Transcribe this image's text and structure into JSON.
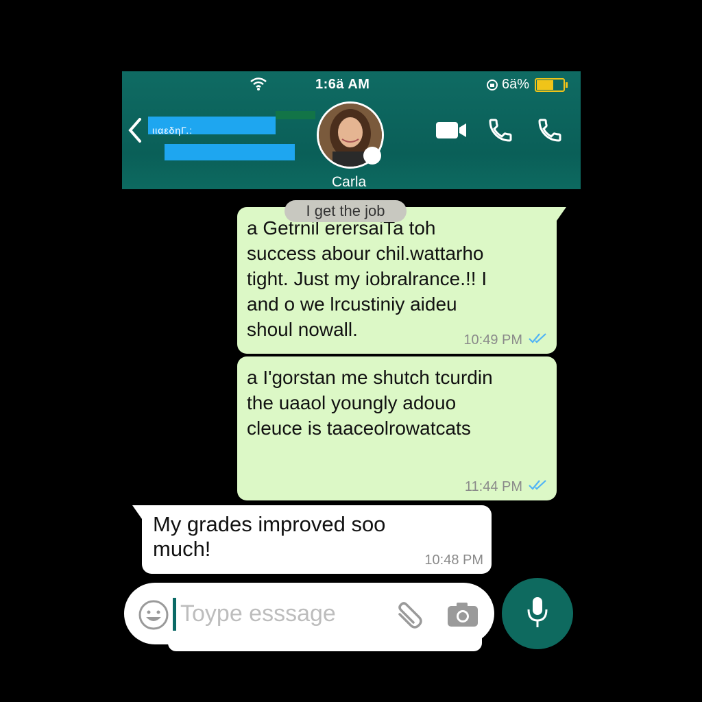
{
  "status_bar": {
    "time": "1:6ä AM",
    "battery_text": "6ä%",
    "battery_level": 0.6,
    "battery_color": "#f0c419"
  },
  "header": {
    "back_icon": "chevron-left-icon",
    "contact_subtitle": "ιιαεδηΓ.:",
    "contact_name": "Carla",
    "icons": [
      "video-camera-icon",
      "phone-icon",
      "phone-icon"
    ],
    "background": "#0f6b63"
  },
  "pill": "I get the job",
  "messages": [
    {
      "direction": "outgoing",
      "text": "a Getrnil erersaiTa toh\nsuccess abour chil.wattarho\ntight. Just my iobralrance.!! I\nand o we lrcustiniy aideu\nshoul nowall.",
      "time": "10:49 PM",
      "ticks": "read"
    },
    {
      "direction": "outgoing",
      "text": "a I'gorstan me shutch tcurdin\nthe uaaol youngly adouo\ncleuce is taaceolrowatcats",
      "time": "11:44 PM",
      "ticks": "read"
    },
    {
      "direction": "incoming",
      "text": "My grades improved soo\nmuch!",
      "time": "10:48 PM"
    }
  ],
  "composer": {
    "placeholder": "Toype esssage",
    "icons": [
      "emoji-icon",
      "paperclip-icon",
      "camera-icon"
    ]
  },
  "mic_button": {
    "icon": "microphone-icon",
    "color": "#0e6a5f"
  },
  "colors": {
    "outgoing_bubble": "#dcf8c6",
    "incoming_bubble": "#ffffff",
    "read_tick": "#4fb3f6"
  }
}
